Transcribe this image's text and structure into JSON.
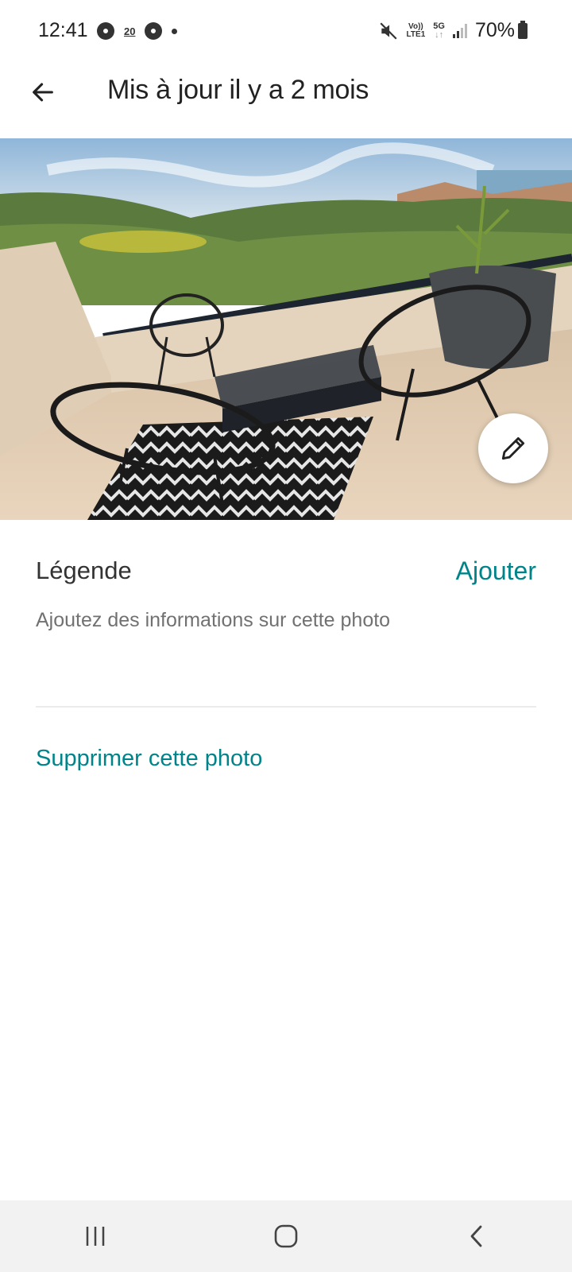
{
  "status_bar": {
    "time": "12:41",
    "mini_label": "20",
    "volte_top": "Vo))",
    "volte_bottom": "LTE1",
    "network": "5G",
    "battery": "70%"
  },
  "header": {
    "title": "Mis à jour il y a 2 mois",
    "back_icon": "arrow-left-icon"
  },
  "photo": {
    "edit_icon": "pencil-icon"
  },
  "caption": {
    "label": "Légende",
    "add_label": "Ajouter",
    "description": "Ajoutez des informations sur cette photo"
  },
  "actions": {
    "delete_label": "Supprimer cette photo"
  },
  "colors": {
    "accent": "#008489",
    "text_primary": "#222222",
    "text_secondary": "#717171",
    "divider": "#ebebeb"
  },
  "nav_bar": {
    "recents_icon": "recents-icon",
    "home_icon": "home-icon",
    "back_icon": "chevron-left-icon"
  }
}
